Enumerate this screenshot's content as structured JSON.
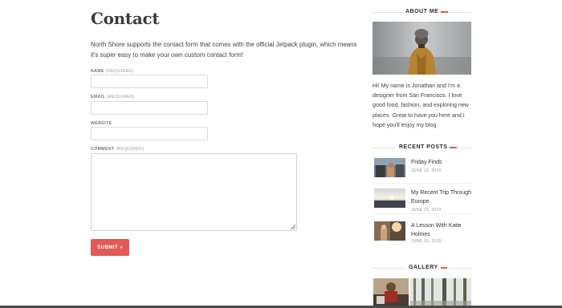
{
  "main": {
    "title": "Contact",
    "intro": "North Shore supports the contact form that comes with the official Jetpack plugin, which means it's super easy to make your own custom contact form!",
    "fields": {
      "name_label": "NAME",
      "name_req": "(REQUIRED)",
      "email_label": "EMAIL",
      "email_req": "(REQUIRED)",
      "website_label": "WEBSITE",
      "comment_label": "COMMENT",
      "comment_req": "(REQUIRED)"
    },
    "submit_label": "SUBMIT »"
  },
  "sidebar": {
    "about": {
      "heading": "ABOUT ME",
      "text": "Hi! My name is Jonathan and I'm a designer from San Francisco. I love good food, fashion, and exploring new places. Great to have you here and I hope you'll enjoy my blog."
    },
    "recent_posts": {
      "heading": "RECENT POSTS",
      "items": [
        {
          "title": "Friday Finds",
          "date": "JUNE 15, 2015"
        },
        {
          "title": "My Recent Trip Through Europe",
          "date": "JUNE 15, 2015"
        },
        {
          "title": "A Lesson With Katie Holmes",
          "date": "JUNE 15, 2015"
        }
      ]
    },
    "gallery": {
      "heading": "GALLERY"
    }
  },
  "colors": {
    "accent": "#e05a56",
    "text": "#3a3a3a",
    "border": "#dadada"
  }
}
